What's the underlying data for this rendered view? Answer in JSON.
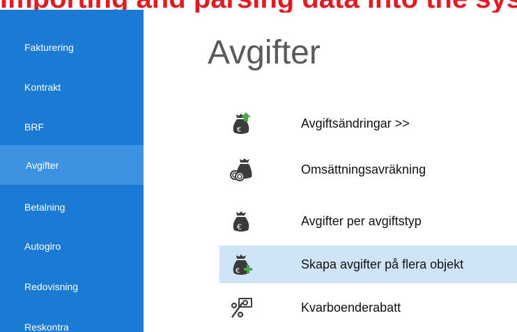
{
  "header": {
    "partial_title": "Importing and parsing data into the system"
  },
  "sidebar": {
    "items": [
      {
        "label": "Fakturering"
      },
      {
        "label": "Kontrakt"
      },
      {
        "label": "BRF"
      },
      {
        "label": "Avgifter",
        "active": true
      },
      {
        "label": "Betalning"
      },
      {
        "label": "Autogiro"
      },
      {
        "label": "Redovisning"
      },
      {
        "label": "Reskontra"
      }
    ]
  },
  "main": {
    "title": "Avgifter",
    "actions": [
      {
        "label": "Avgiftsändringar >>",
        "icon": "money-bag-euro-up-arrow-icon"
      },
      {
        "label": "Omsättningsavräkning",
        "icon": "money-bag-coins-icon"
      },
      {
        "label": "Avgifter per avgiftstyp",
        "icon": "money-bag-euro-icon"
      },
      {
        "label": "Skapa avgifter på flera objekt",
        "icon": "money-bag-euro-plus-icon",
        "active": true
      },
      {
        "label": "Kvarboenderabatt",
        "icon": "percent-discount-icon"
      }
    ]
  },
  "colors": {
    "sidebar": "#1a7ad4",
    "sidebar_active": "#3d93e2",
    "action_active": "#cfe5f7",
    "heading_red": "#e01b24"
  }
}
